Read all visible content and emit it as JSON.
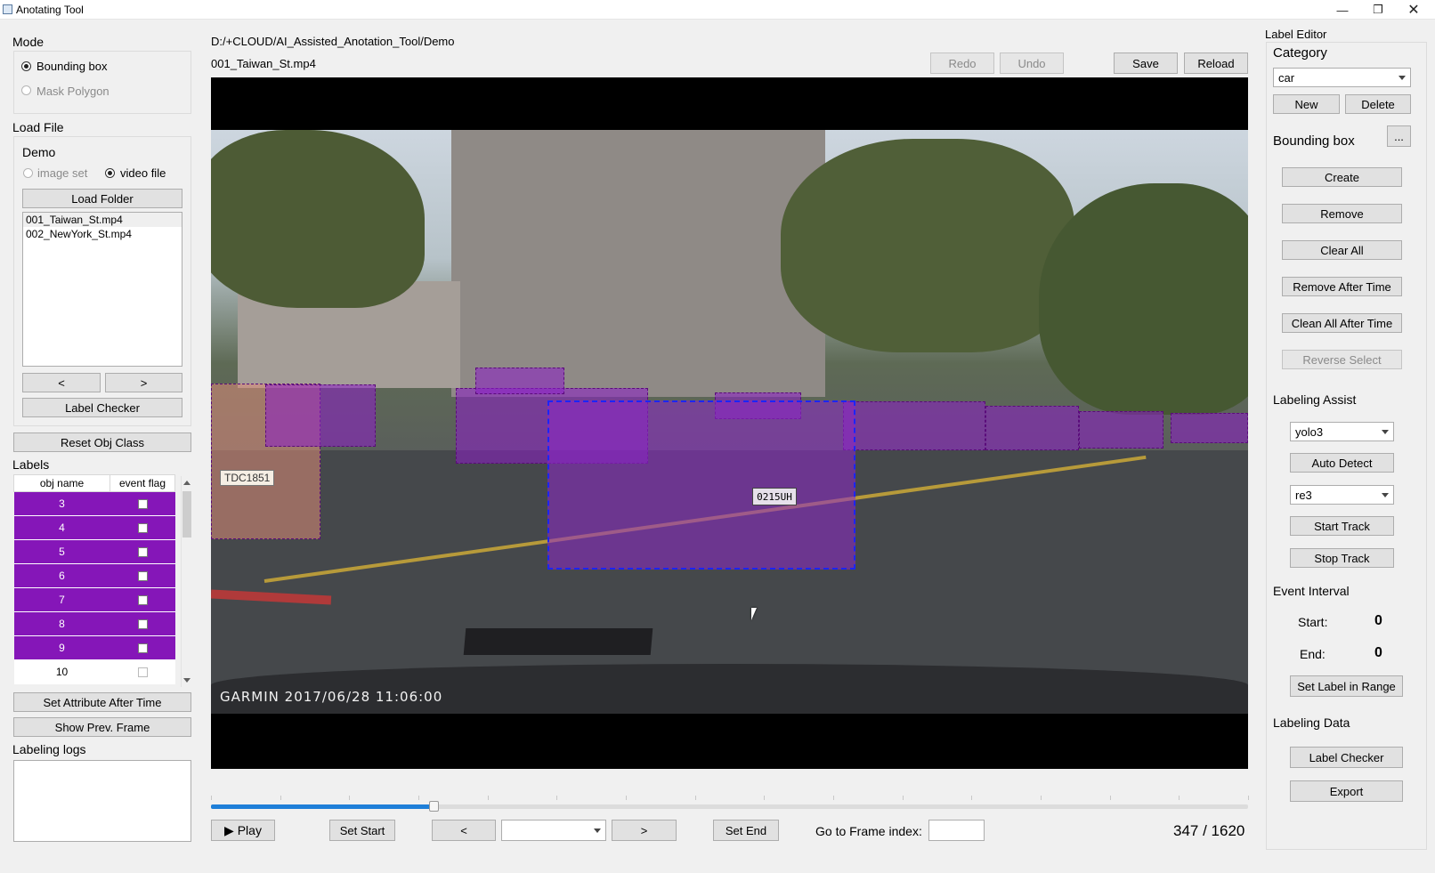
{
  "window": {
    "title": "Anotating Tool"
  },
  "mode": {
    "heading": "Mode",
    "options": [
      "Bounding box",
      "Mask Polygon"
    ],
    "selected": 0
  },
  "load_file": {
    "heading": "Load File",
    "group_title": "Demo",
    "options": [
      "image set",
      "video file"
    ],
    "selected": 1,
    "load_folder_label": "Load Folder",
    "files": [
      "001_Taiwan_St.mp4",
      "002_NewYork_St.mp4"
    ],
    "prev_label": "<",
    "next_label": ">",
    "label_checker_label": "Label Checker"
  },
  "reset_obj_class_label": "Reset Obj Class",
  "labels": {
    "heading": "Labels",
    "columns": [
      "obj name",
      "event flag"
    ],
    "rows": [
      "3",
      "4",
      "5",
      "6",
      "7",
      "8",
      "9",
      "10"
    ]
  },
  "set_attribute_label": "Set Attribute After Time",
  "show_prev_frame_label": "Show Prev. Frame",
  "labeling_logs_heading": "Labeling logs",
  "header": {
    "path": "D:/+CLOUD/AI_Assisted_Anotation_Tool/Demo",
    "filename": "001_Taiwan_St.mp4",
    "redo_label": "Redo",
    "undo_label": "Undo",
    "save_label": "Save",
    "reload_label": "Reload"
  },
  "video": {
    "overlay_text": "GARMIN 2017/06/28 11:06:00",
    "plate_text": "0215UH",
    "taxi_text": "TDC1851"
  },
  "playback": {
    "play_label": "▶ Play",
    "set_start_label": "Set Start",
    "prev_label": "<",
    "next_label": ">",
    "frame_combo_value": "",
    "set_end_label": "Set End",
    "goto_label": "Go to Frame index:",
    "goto_value": "",
    "frame_counter": "347 / 1620",
    "progress_fraction": 0.2142
  },
  "label_editor": {
    "heading": "Label Editor",
    "category_heading": "Category",
    "category_value": "car",
    "new_label": "New",
    "delete_label": "Delete",
    "bbox_heading": "Bounding box",
    "ellipsis_label": "...",
    "create_label": "Create",
    "remove_label": "Remove",
    "clear_all_label": "Clear All",
    "remove_after_time_label": "Remove After Time",
    "clean_all_after_time_label": "Clean All After Time",
    "reverse_select_label": "Reverse Select",
    "labeling_assist_heading": "Labeling Assist",
    "detector_value": "yolo3",
    "auto_detect_label": "Auto Detect",
    "tracker_value": "re3",
    "start_track_label": "Start Track",
    "stop_track_label": "Stop Track",
    "event_interval_heading": "Event Interval",
    "start_label": "Start:",
    "start_value": "0",
    "end_label": "End:",
    "end_value": "0",
    "set_label_in_range_label": "Set Label in Range",
    "labeling_data_heading": "Labeling Data",
    "label_checker_label": "Label Checker",
    "export_label": "Export"
  },
  "colors": {
    "label_row": "#8516b8",
    "bbox_fill": "#8c1ec8",
    "selected_bbox_border": "#1d24ff",
    "progress": "#1e7fd8"
  }
}
